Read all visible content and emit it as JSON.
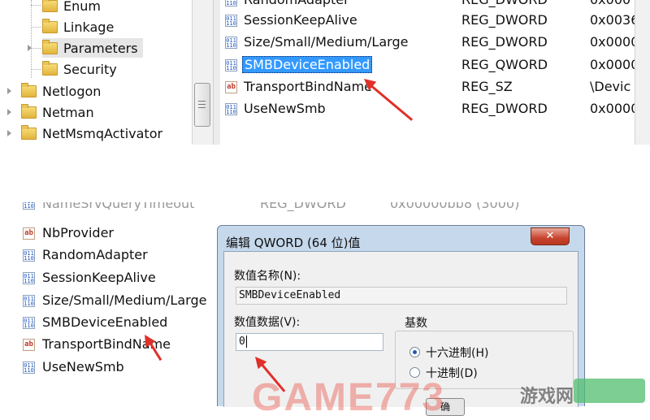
{
  "tree": {
    "items": [
      {
        "label": "Enum"
      },
      {
        "label": "Linkage"
      },
      {
        "label": "Parameters"
      },
      {
        "label": "Security"
      },
      {
        "label": "Netlogon"
      },
      {
        "label": "Netman"
      },
      {
        "label": "NetMsmqActivator"
      }
    ]
  },
  "values_top": {
    "rows": [
      {
        "name": "RandomAdapter",
        "type": "REG_DWORD",
        "data": "0x000",
        "icon": "binary-value-icon"
      },
      {
        "name": "SessionKeepAlive",
        "type": "REG_DWORD",
        "data": "0x0036",
        "icon": "binary-value-icon"
      },
      {
        "name": "Size/Small/Medium/Large",
        "type": "REG_DWORD",
        "data": "0x0000",
        "icon": "binary-value-icon"
      },
      {
        "name": "SMBDeviceEnabled",
        "type": "REG_QWORD",
        "data": "0x0000",
        "icon": "binary-value-icon"
      },
      {
        "name": "TransportBindName",
        "type": "REG_SZ",
        "data": "\\Devic",
        "icon": "string-value-icon"
      },
      {
        "name": "UseNewSmb",
        "type": "REG_DWORD",
        "data": "0x0000",
        "icon": "binary-value-icon"
      }
    ]
  },
  "values_bottom": {
    "partial_row": {
      "name": "NameSrvQueryTimeout",
      "type": "REG_DWORD",
      "data": "0x00000bb8 (3000)"
    },
    "rows": [
      {
        "name": "NbProvider",
        "icon": "string-value-icon"
      },
      {
        "name": "RandomAdapter",
        "icon": "binary-value-icon"
      },
      {
        "name": "SessionKeepAlive",
        "icon": "binary-value-icon"
      },
      {
        "name": "Size/Small/Medium/Large",
        "icon": "binary-value-icon"
      },
      {
        "name": "SMBDeviceEnabled",
        "icon": "binary-value-icon"
      },
      {
        "name": "TransportBindName",
        "icon": "string-value-icon"
      },
      {
        "name": "UseNewSmb",
        "icon": "binary-value-icon"
      }
    ]
  },
  "dialog": {
    "title": "编辑 QWORD (64 位)值",
    "close_label": "✕",
    "value_name_label": "数值名称(N):",
    "value_name": "SMBDeviceEnabled",
    "value_data_label": "数值数据(V):",
    "value_data": "0",
    "base_label": "基数",
    "radio_hex": "十六进制(H)",
    "radio_dec": "十进制(D)",
    "selected_base": "hex",
    "ok_label": "确"
  },
  "icons": {
    "binary": "binary-value-icon",
    "string": "string-value-icon",
    "folder": "folder-icon",
    "expander": "expand-arrow-icon",
    "annotation": "red-arrow-icon"
  },
  "colors": {
    "selection": "#3399ff",
    "annotation_arrow": "#e0302a",
    "dialog_frame": "#c6d8ec"
  },
  "watermark": {
    "text": "GAME773",
    "site": "游戏网"
  }
}
